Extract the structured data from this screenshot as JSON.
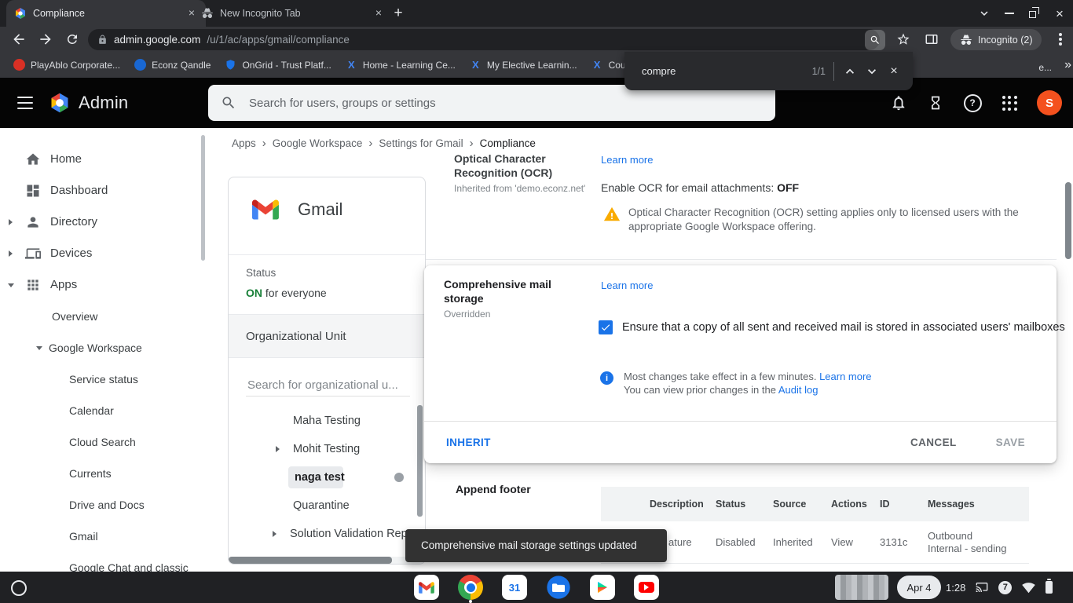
{
  "theme": {
    "accent_blue": "#1a73e8",
    "status_green_on": "#188038",
    "warning_amber": "#f9ab00",
    "avatar_orange": "#f4511e",
    "toast_bg": "#323232",
    "chrome_frame": "#202124",
    "chrome_toolbar": "#35363a"
  },
  "icons": {
    "close_x": "×",
    "new_tab_plus": "+",
    "bookmarks_overflow": "»",
    "breadcrumb_separator": "›",
    "help_question": "?",
    "info_i": "i",
    "x_logo": "X"
  },
  "browser": {
    "tabs": [
      {
        "title": "Compliance"
      },
      {
        "title": "New Incognito Tab"
      }
    ],
    "url": {
      "host": "admin.google.com",
      "path": "/u/1/ac/apps/gmail/compliance"
    },
    "incognito_badge": "Incognito (2)",
    "find_bar": {
      "query": "compre",
      "matches": "1/1"
    },
    "bookmarks": [
      {
        "label": "PlayAblo Corporate..."
      },
      {
        "label": "Econz Qandle"
      },
      {
        "label": "OnGrid - Trust Platf..."
      },
      {
        "label": "Home - Learning Ce..."
      },
      {
        "label": "My Elective Learnin..."
      },
      {
        "label": "Cours..."
      },
      {
        "label": "e..."
      }
    ]
  },
  "header": {
    "brand": "Admin",
    "search_placeholder": "Search for users, groups or settings",
    "avatar_initial": "S"
  },
  "sidebar": {
    "items": [
      {
        "label": "Home"
      },
      {
        "label": "Dashboard"
      },
      {
        "label": "Directory"
      },
      {
        "label": "Devices"
      },
      {
        "label": "Apps"
      },
      {
        "label": "Overview"
      },
      {
        "label": "Google Workspace"
      },
      {
        "label": "Service status"
      },
      {
        "label": "Calendar"
      },
      {
        "label": "Cloud Search"
      },
      {
        "label": "Currents"
      },
      {
        "label": "Drive and Docs"
      },
      {
        "label": "Gmail"
      },
      {
        "label": "Google Chat and classic"
      }
    ]
  },
  "breadcrumb": {
    "items": [
      {
        "label": "Apps"
      },
      {
        "label": "Google Workspace"
      },
      {
        "label": "Settings for Gmail"
      },
      {
        "label": "Compliance"
      }
    ]
  },
  "gmail_panel": {
    "title": "Gmail",
    "status_label": "Status",
    "status_on": "ON",
    "status_rest": " for everyone",
    "org_unit_label": "Organizational Unit",
    "org_search_placeholder": "Search for organizational u...",
    "tree": [
      {
        "label": "Maha Testing"
      },
      {
        "label": "Mohit Testing"
      },
      {
        "label": "naga test"
      },
      {
        "label": "Quarantine"
      },
      {
        "label": "Solution Validation Rep"
      }
    ]
  },
  "ocr_setting": {
    "title": "Optical Character Recognition (OCR)",
    "inherited_from": "Inherited from 'demo.econz.net'",
    "learn_more": "Learn more",
    "status_prefix": "Enable OCR for email attachments: ",
    "status_value": "OFF",
    "warning_text": "Optical Character Recognition (OCR) setting applies only to licensed users with the appropriate Google Workspace offering."
  },
  "storage_dialog": {
    "title": "Comprehensive mail storage",
    "state": "Overridden",
    "learn_more": "Learn more",
    "checkbox_label": "Ensure that a copy of all sent and received mail is stored in associated users' mailboxes",
    "note_line1": "Most changes take effect in a few minutes. ",
    "note_line1_link": "Learn more",
    "note_line2": "You can view prior changes in the ",
    "note_line2_link": "Audit log",
    "inherit_button": "INHERIT",
    "cancel_button": "CANCEL",
    "save_button": "SAVE"
  },
  "append_footer": {
    "title": "Append footer",
    "columns": [
      "Description",
      "Status",
      "Source",
      "Actions",
      "ID",
      "Messages"
    ],
    "row": {
      "description_visible": "ature",
      "status": "Disabled",
      "source": "Inherited",
      "action": "View",
      "id": "3131c",
      "message_line1": "Outbound",
      "message_line2": "Internal - sending"
    }
  },
  "toast": {
    "message": "Comprehensive mail storage settings updated"
  },
  "shelf": {
    "date": "Apr 4",
    "time": "1:28",
    "notification_count": "7",
    "calendar_icon_text": "31"
  }
}
